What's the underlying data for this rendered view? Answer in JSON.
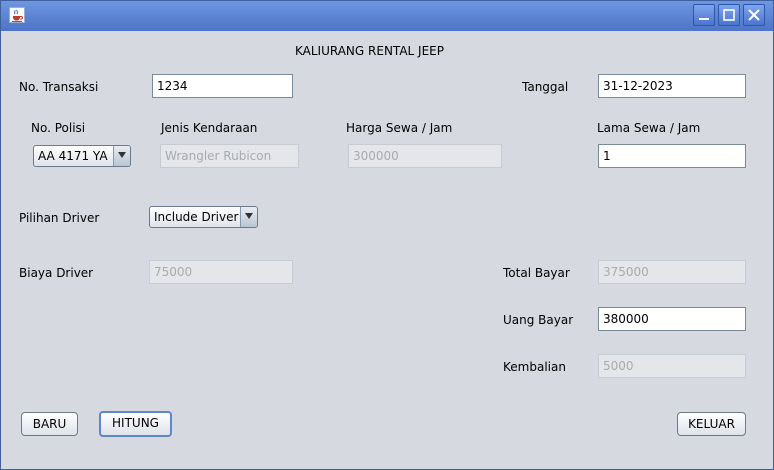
{
  "window": {
    "app_icon": "java-cup-icon",
    "controls": [
      "minimize-icon",
      "maximize-icon",
      "close-icon"
    ]
  },
  "form": {
    "title": "KALIURANG RENTAL JEEP",
    "no_transaksi": {
      "label": "No. Transaksi",
      "value": "1234"
    },
    "tanggal": {
      "label": "Tanggal",
      "value": "31-12-2023"
    },
    "no_polisi": {
      "label": "No. Polisi",
      "value": "AA 4171 YA"
    },
    "jenis_kendaraan": {
      "label": "Jenis Kendaraan",
      "value": "Wrangler Rubicon"
    },
    "harga_sewa": {
      "label": "Harga Sewa / Jam",
      "value": "300000"
    },
    "lama_sewa": {
      "label": "Lama Sewa / Jam",
      "value": "1"
    },
    "pilihan_driver": {
      "label": "Pilihan Driver",
      "value": "Include Driver"
    },
    "biaya_driver": {
      "label": "Biaya Driver",
      "value": "75000"
    },
    "total_bayar": {
      "label": "Total Bayar",
      "value": "375000"
    },
    "uang_bayar": {
      "label": "Uang Bayar",
      "value": "380000"
    },
    "kembalian": {
      "label": "Kembalian",
      "value": "5000"
    }
  },
  "buttons": {
    "baru": "BARU",
    "hitung": "HITUNG",
    "keluar": "KELUAR"
  }
}
